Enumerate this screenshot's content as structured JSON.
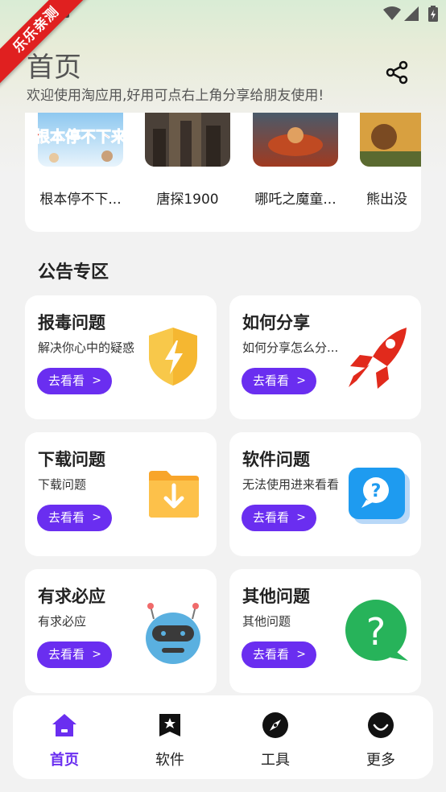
{
  "ribbon": {
    "text": "乐乐亲测"
  },
  "header": {
    "title": "首页",
    "subtitle": "欢迎使用淘应用,好用可点右上角分享给朋友使用!"
  },
  "movies": [
    {
      "title": "根本停不下...",
      "poster_text": "根本停不下来"
    },
    {
      "title": "唐探1900"
    },
    {
      "title": "哪吒之魔童..."
    },
    {
      "title": "熊出没"
    }
  ],
  "section": {
    "title": "公告专区"
  },
  "cards": [
    {
      "title": "报毒问题",
      "desc": "解决你心中的疑惑",
      "button": "去看看"
    },
    {
      "title": "如何分享",
      "desc": "如何分享怎么分...",
      "button": "去看看"
    },
    {
      "title": "下载问题",
      "desc": "下载问题",
      "button": "去看看"
    },
    {
      "title": "软件问题",
      "desc": "无法使用进来看看",
      "button": "去看看"
    },
    {
      "title": "有求必应",
      "desc": "有求必应",
      "button": "去看看"
    },
    {
      "title": "其他问题",
      "desc": "其他问题",
      "button": "去看看"
    }
  ],
  "nav": [
    {
      "label": "首页",
      "icon": "home-icon",
      "active": true
    },
    {
      "label": "软件",
      "icon": "bookmark-star-icon"
    },
    {
      "label": "工具",
      "icon": "compass-icon"
    },
    {
      "label": "更多",
      "icon": "smile-icon"
    }
  ],
  "colors": {
    "accent": "#6a2ef0",
    "ribbon": "#e02020",
    "card_bg": "#ffffff"
  }
}
